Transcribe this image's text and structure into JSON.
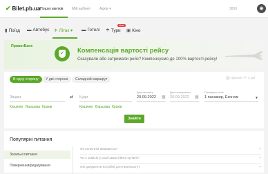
{
  "header": {
    "logo": "Bilet.pb.ua",
    "nav": [
      "Пошук квитків",
      "Мій кабінет",
      "Архів ▾"
    ],
    "phone": "3600",
    "avatar_initial": "●"
  },
  "tabs": [
    {
      "label": "Поїзд",
      "icon": "train-icon",
      "glyph": "▮"
    },
    {
      "label": "Автобус",
      "icon": "bus-icon",
      "glyph": "▬"
    },
    {
      "label": "Літак ▾",
      "icon": "plane-icon",
      "glyph": "✈"
    },
    {
      "label": "Готелі",
      "icon": "bed-icon",
      "glyph": "▬"
    },
    {
      "label": "Тури",
      "icon": "tour-icon",
      "glyph": "☂"
    },
    {
      "label": "Кіно",
      "icon": "cinema-icon",
      "glyph": "▣"
    }
  ],
  "tab_badge": "Нове",
  "banner": {
    "bank": "ПриватБанк",
    "title": "Компенсація вартості рейсу",
    "subtitle": "Скасували або затримали рейс? Компенсуємо до 100% вартості рейсу!"
  },
  "search": {
    "trip_types": [
      "В одну сторону",
      "У дві сторони",
      "Складний маршрут"
    ],
    "compare": "Шукати +/- 3 дні",
    "from_label": "Звідки",
    "to_label": "Куди",
    "depart_label": "Дата вильоту",
    "depart_value": "20.09.2022",
    "return_label": "Дата повернення",
    "return_value": "20.09.2022",
    "passengers_label": "Пасажири, клас",
    "passengers_value": "1 пасажир, Економ",
    "quick_from": [
      "Кишинів",
      "Варшава",
      "Краків"
    ],
    "quick_to": [
      "Кишинів",
      "Варшава",
      "Краків"
    ],
    "find_button": "Знайти"
  },
  "faq": {
    "title": "Популярні питання",
    "nav": [
      "Загальні питання",
      "Повернення/редагування"
    ],
    "questions": [
      "Як оплатити авіаквиток?",
      "Чи є комісія у разі самостійної купівлі?",
      "Які документи потрібні для перельоту?"
    ]
  },
  "colors": {
    "accent": "#5ca829"
  }
}
